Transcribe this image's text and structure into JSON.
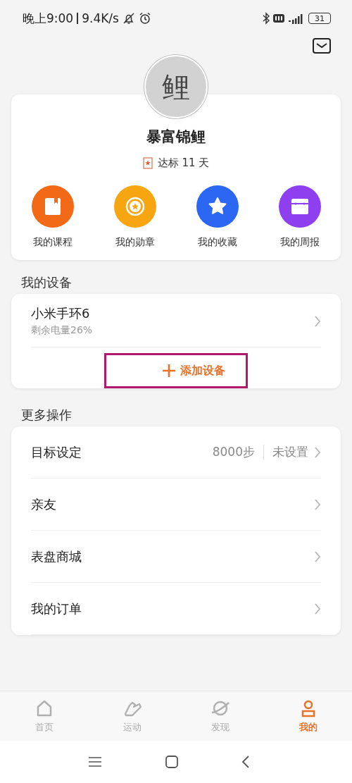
{
  "status_bar": {
    "time": "晚上9:00",
    "speed": "9.4K/s",
    "battery": "31"
  },
  "profile": {
    "avatar_text": "鲤",
    "name": "暴富锦鲤",
    "badge": "达标 11 天"
  },
  "shortcuts": [
    {
      "label": "我的课程",
      "kind": "course",
      "color": "#f26a17"
    },
    {
      "label": "我的勋章",
      "kind": "medal",
      "color": "#f7a511"
    },
    {
      "label": "我的收藏",
      "kind": "favorite",
      "color": "#2b67f2"
    },
    {
      "label": "我的周报",
      "kind": "report",
      "color": "#8e3ff0"
    }
  ],
  "devices_section": {
    "title": "我的设备",
    "devices": [
      {
        "name": "小米手环6",
        "detail": "剩余电量26%"
      }
    ],
    "add_button": {
      "label": "添加设备",
      "highlighted": true
    }
  },
  "more_section": {
    "title": "更多操作",
    "items": [
      {
        "label": "目标设定",
        "value": "8000步",
        "extra": "未设置"
      },
      {
        "label": "亲友"
      },
      {
        "label": "表盘商城"
      },
      {
        "label": "我的订单"
      }
    ]
  },
  "tabs": [
    {
      "label": "首页",
      "kind": "home",
      "selected": false
    },
    {
      "label": "运动",
      "kind": "sport",
      "selected": false
    },
    {
      "label": "发现",
      "kind": "discover",
      "selected": false
    },
    {
      "label": "我的",
      "kind": "me",
      "selected": true
    }
  ]
}
